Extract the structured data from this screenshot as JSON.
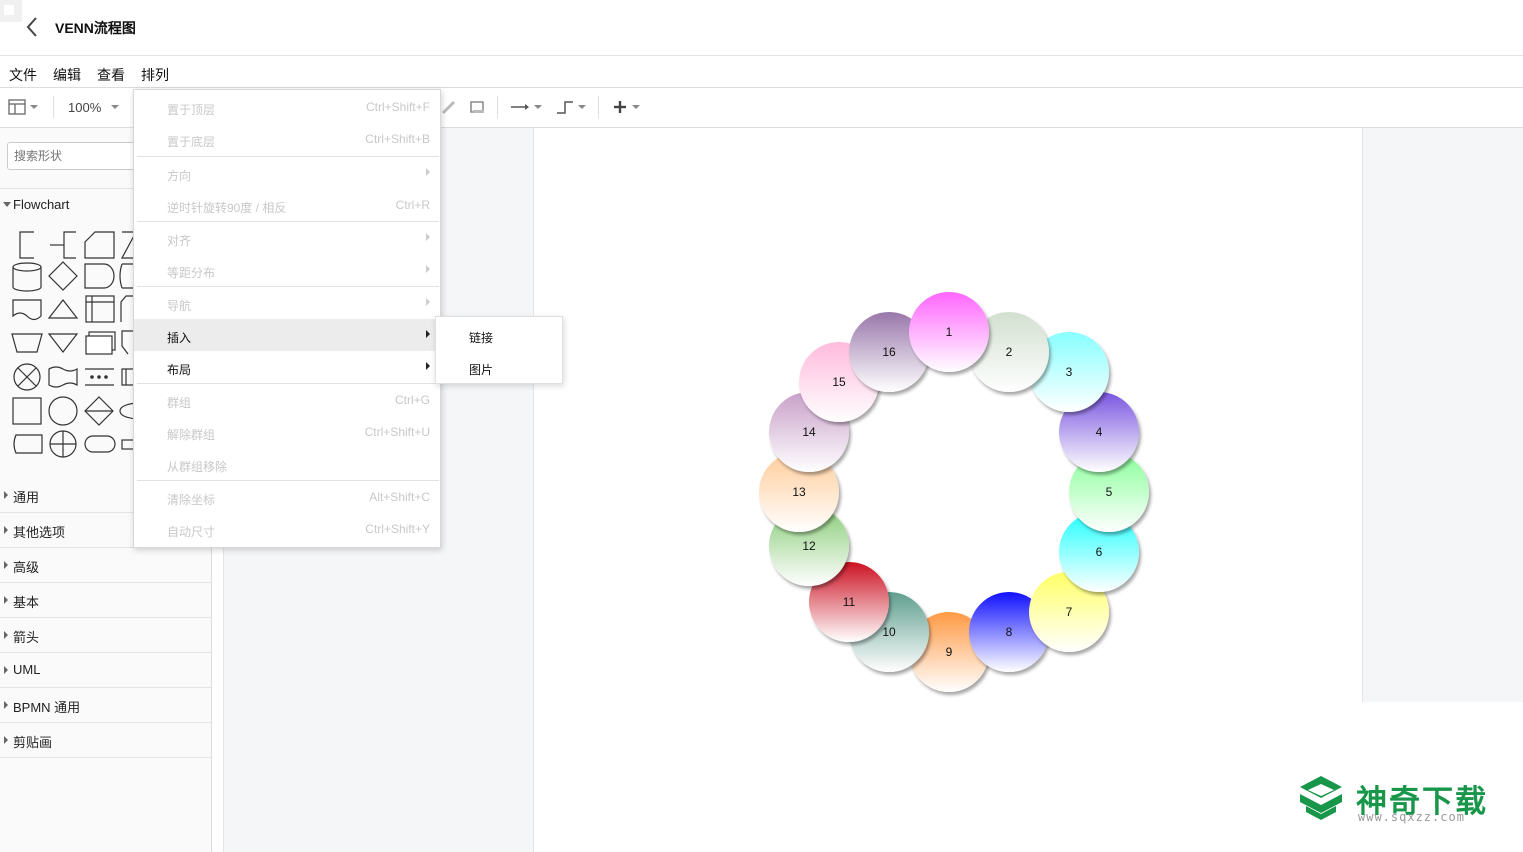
{
  "document": {
    "title": "VENN流程图"
  },
  "menubar": [
    {
      "label": "文件"
    },
    {
      "label": "编辑"
    },
    {
      "label": "查看"
    },
    {
      "label": "排列"
    }
  ],
  "toolbar": {
    "zoom": "100%"
  },
  "sidebar": {
    "search_placeholder": "搜索形状",
    "flowchart_label": "Flowchart",
    "categories": [
      "通用",
      "其他选项",
      "高级",
      "基本",
      "箭头",
      "UML",
      "BPMN 通用",
      "剪贴画"
    ]
  },
  "arrange_menu": {
    "items": [
      {
        "label": "置于顶层",
        "shortcut": "Ctrl+Shift+F"
      },
      {
        "label": "置于底层",
        "shortcut": "Ctrl+Shift+B"
      },
      {
        "label": "方向",
        "shortcut": ""
      },
      {
        "label": "逆时针旋转90度 / 相反",
        "shortcut": "Ctrl+R"
      },
      {
        "label": "对齐",
        "shortcut": ""
      },
      {
        "label": "等距分布",
        "shortcut": ""
      },
      {
        "label": "导航",
        "shortcut": ""
      },
      {
        "label": "插入",
        "shortcut": ""
      },
      {
        "label": "布局",
        "shortcut": ""
      },
      {
        "label": "群组",
        "shortcut": "Ctrl+G"
      },
      {
        "label": "解除群组",
        "shortcut": "Ctrl+Shift+U"
      },
      {
        "label": "从群组移除",
        "shortcut": ""
      },
      {
        "label": "清除坐标",
        "shortcut": "Alt+Shift+C"
      },
      {
        "label": "自动尺寸",
        "shortcut": "Ctrl+Shift+Y"
      }
    ]
  },
  "insert_submenu": {
    "items": [
      {
        "label": "链接"
      },
      {
        "label": "图片"
      }
    ]
  },
  "venn": {
    "circles": [
      {
        "label": "1",
        "color": "#ff66ff"
      },
      {
        "label": "2",
        "color": "#d2e0d0"
      },
      {
        "label": "3",
        "color": "#88ffff"
      },
      {
        "label": "4",
        "color": "#7a55e0"
      },
      {
        "label": "5",
        "color": "#88ff99"
      },
      {
        "label": "6",
        "color": "#22ffff"
      },
      {
        "label": "7",
        "color": "#ffff66"
      },
      {
        "label": "8",
        "color": "#1010ff"
      },
      {
        "label": "9",
        "color": "#ff9944"
      },
      {
        "label": "10",
        "color": "#5f9e8e"
      },
      {
        "label": "11",
        "color": "#cc1122"
      },
      {
        "label": "12",
        "color": "#88cc77"
      },
      {
        "label": "13",
        "color": "#ffcc99"
      },
      {
        "label": "14",
        "color": "#c8a0c8"
      },
      {
        "label": "15",
        "color": "#ffbbdd"
      },
      {
        "label": "16",
        "color": "#9977aa"
      }
    ]
  },
  "watermark": {
    "text": "神奇下载",
    "url": "www.sqxzz.com",
    "color": "#18964a"
  }
}
